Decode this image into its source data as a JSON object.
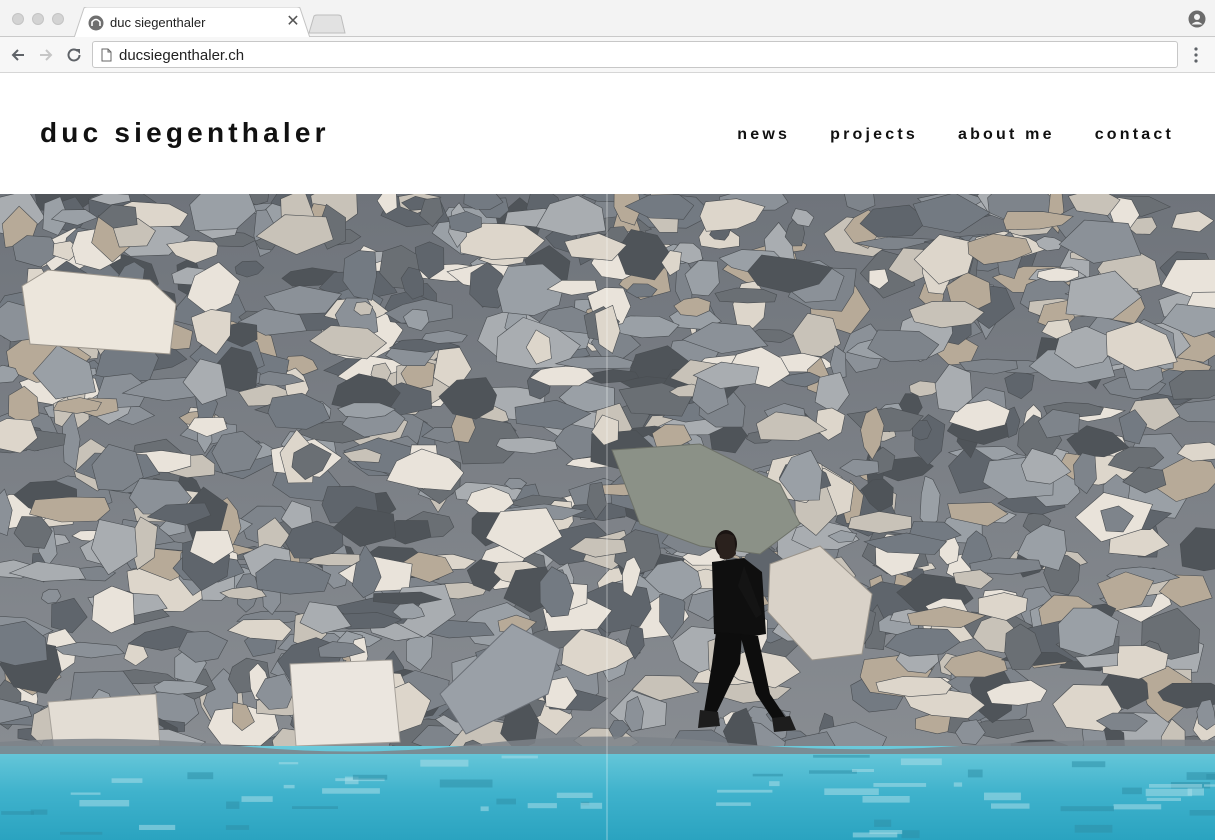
{
  "browser": {
    "tab": {
      "title": "duc siegenthaler",
      "favicon": "site-favicon",
      "close_icon": "close-icon"
    },
    "address": {
      "url": "ducsiegenthaler.ch",
      "page_icon": "page-icon"
    },
    "icons": [
      "back-arrow-icon",
      "forward-arrow-icon",
      "reload-icon",
      "profile-icon",
      "menu-dots-icon"
    ]
  },
  "site": {
    "title": "duc siegenthaler",
    "nav": [
      {
        "label": "news"
      },
      {
        "label": "projects"
      },
      {
        "label": "about me"
      },
      {
        "label": "contact"
      }
    ]
  },
  "hero": {
    "subject": "hero-photo-person-on-rocks-by-lake",
    "colors": {
      "rock": "#8d9399",
      "rock_light": "#e4ddd4",
      "water": "#4fb9d1",
      "person": "#101010"
    }
  }
}
